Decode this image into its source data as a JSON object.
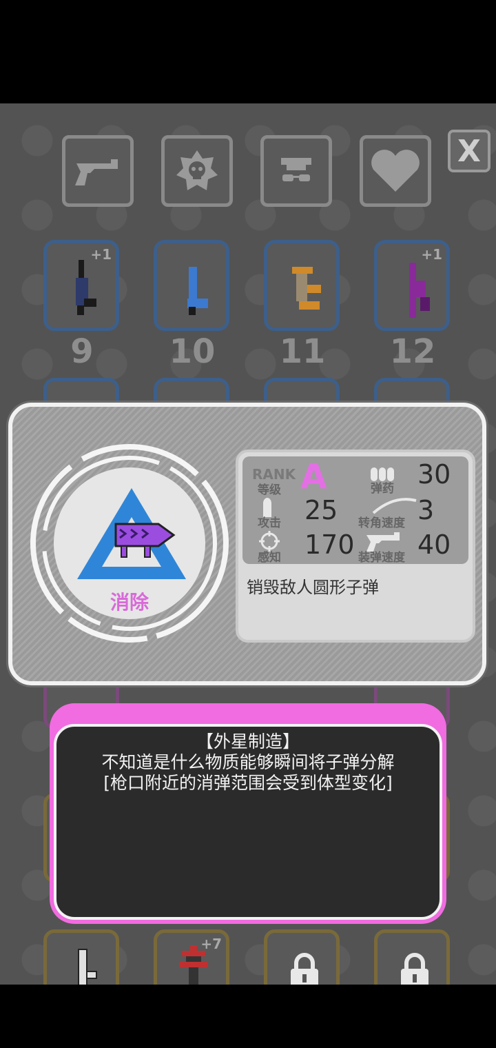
{
  "category_tabs": [
    {
      "icon": "revolver-icon"
    },
    {
      "icon": "skull-badge-icon"
    },
    {
      "icon": "hat-glasses-icon"
    },
    {
      "icon": "heart-icon"
    }
  ],
  "close_label": "X",
  "weapon_slots_row1": [
    {
      "number": "9",
      "bonus": "+1"
    },
    {
      "number": "10",
      "bonus": ""
    },
    {
      "number": "11",
      "bonus": ""
    },
    {
      "number": "12",
      "bonus": "+1"
    }
  ],
  "weapon_slots_bottom": [
    {
      "bonus": ""
    },
    {
      "bonus": "+7"
    },
    {
      "locked": true
    },
    {
      "locked": true
    }
  ],
  "weapon": {
    "name": "消除",
    "rank_label_en": "RANK",
    "rank_label": "等级",
    "rank": "A",
    "ammo_label": "弹药",
    "ammo": "30",
    "attack_label": "攻击",
    "attack": "25",
    "turn_speed_label": "转角速度",
    "turn_speed": "3",
    "perception_label": "感知",
    "perception": "170",
    "reload_label": "装弹速度",
    "reload": "40",
    "description": "销毁敌人圆形子弹"
  },
  "lore": {
    "line1": "【外星制造】",
    "line2": "不知道是什么物质能够瞬间将子弹分解",
    "line3": "[枪口附近的消弹范围会受到体型变化]"
  },
  "colors": {
    "rank_color": "#e46fe4",
    "triangle_blue": "#2f86d8",
    "lore_header_pink": "#f06ce0",
    "weapon_purple": "#9b4de0"
  }
}
